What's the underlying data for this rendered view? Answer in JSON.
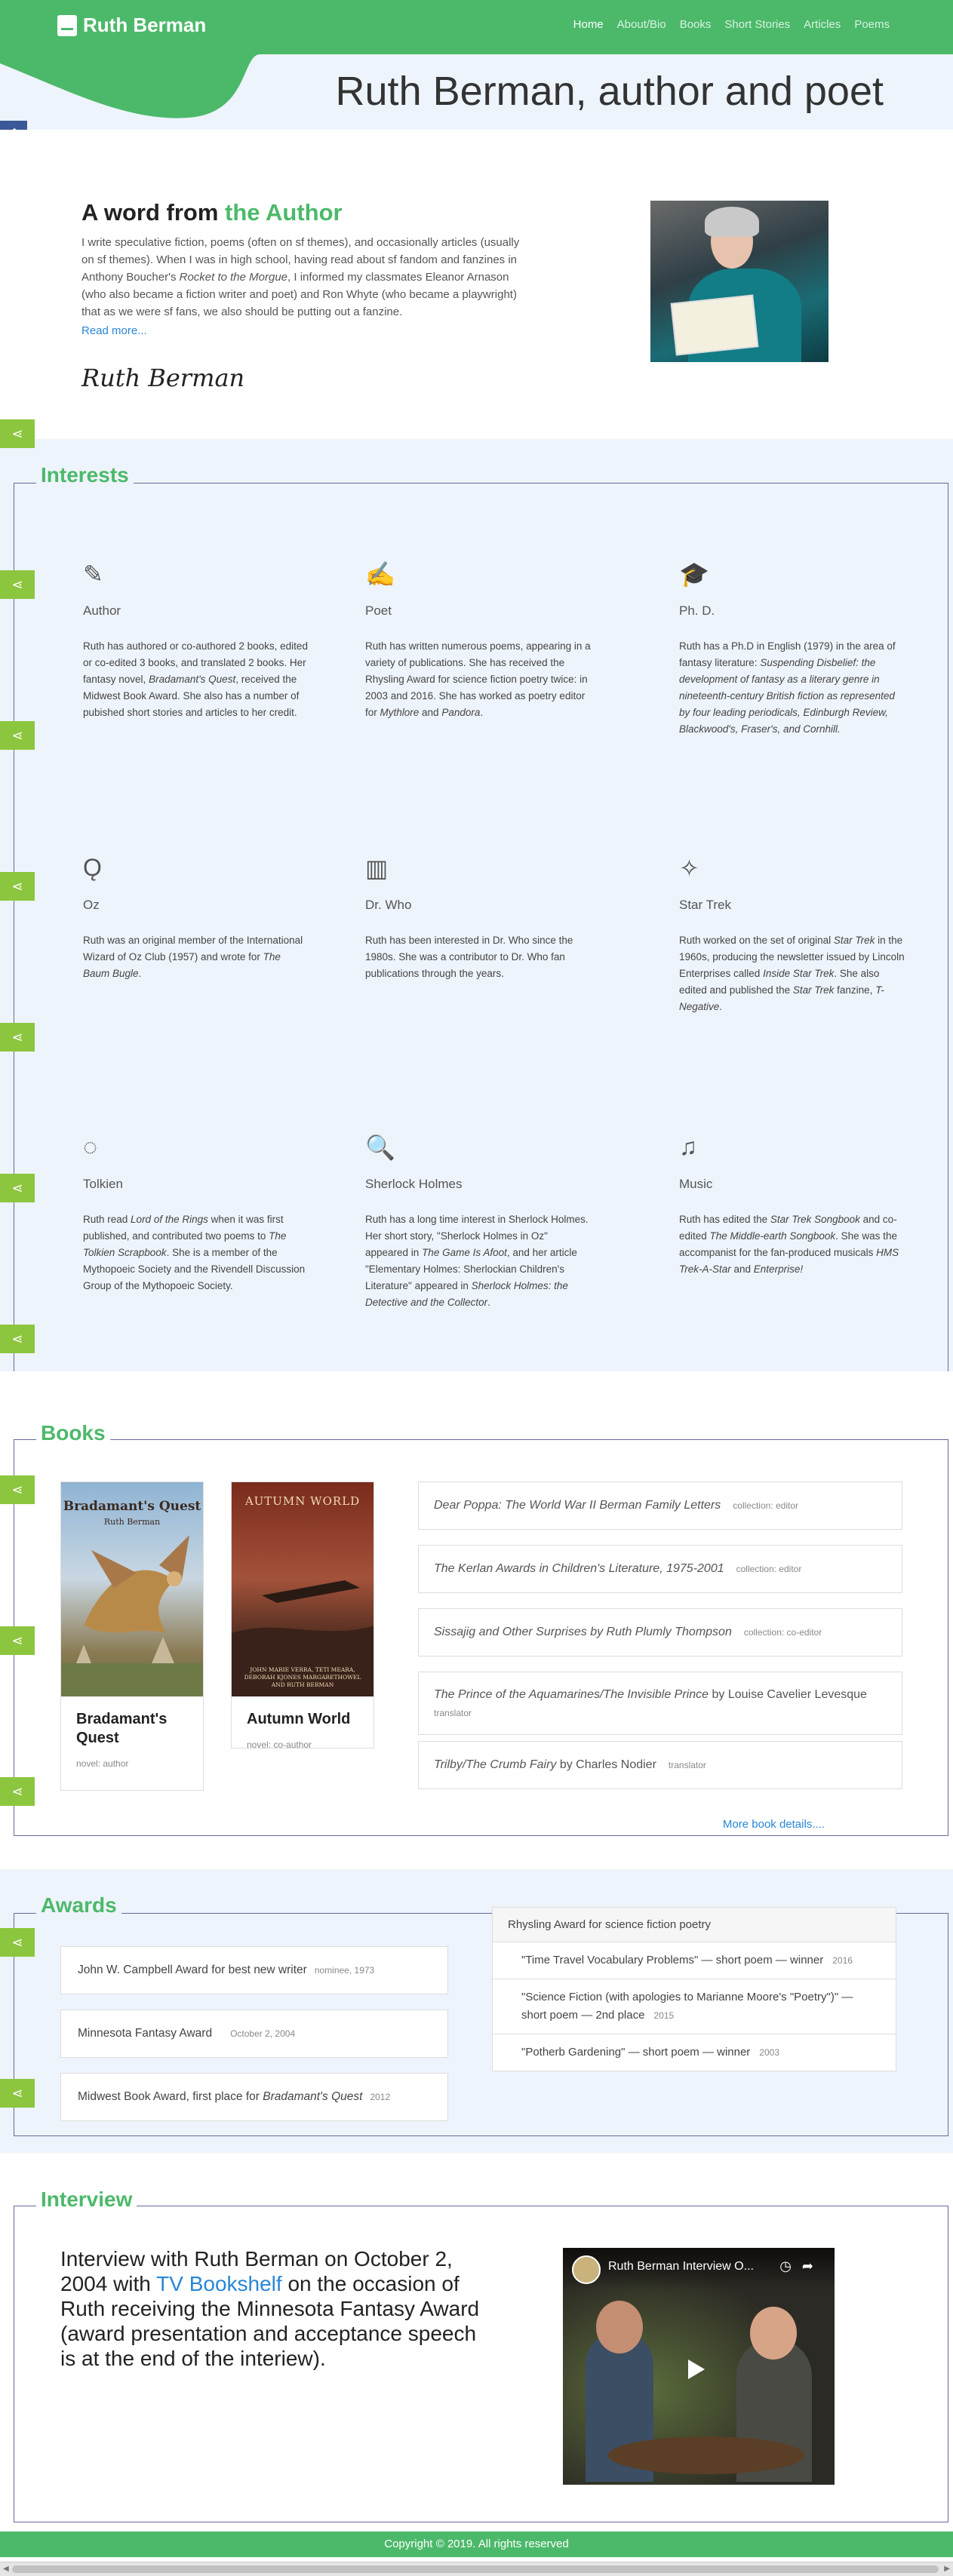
{
  "brand": "Ruth Berman",
  "nav": [
    "Home",
    "About/Bio",
    "Books",
    "Short Stories",
    "Articles",
    "Poems"
  ],
  "hero_title": "Ruth Berman, author and poet",
  "social_icons": {
    "facebook": "f",
    "twitter": "twitter-bird",
    "pinterest": "p",
    "email": "envelope",
    "share": "share"
  },
  "author": {
    "heading_prefix": "A word from",
    "heading_accent": "the Author",
    "bio_1": "I write speculative fiction, poems (often on sf themes), and occasionally articles (usually on sf themes). When I was in high school, having read about sf fandom and fanzines in Anthony Boucher's ",
    "bio_italic": "Rocket to the Morgue",
    "bio_2": ", I informed my classmates Eleanor Arnason (who also became a fiction writer and poet) and Ron Whyte (who became a playwright) that as we were sf fans, we also should be putting out a fanzine.",
    "read_more": "Read more...",
    "signature": "Ruth Berman"
  },
  "interests": {
    "title": "Interests",
    "items": [
      {
        "name": "Author",
        "icon": "✎",
        "text": "Ruth has authored or co-authored 2 books, edited or co-edited 3 books, and translated 2 books. Her fantasy novel, <i>Bradamant's Quest</i>, received the Midwest Book Award. She also has a number of pubished short stories and articles to her credit."
      },
      {
        "name": "Poet",
        "icon": "✍",
        "text": "Ruth has written numerous poems, appearing in a variety of publications. She has received the Rhysling Award for science fiction poetry twice: in 2003 and 2016. She has worked as poetry editor for <i>Mythlore</i> and <i>Pandora</i>."
      },
      {
        "name": "Ph. D.",
        "icon": "🎓",
        "text": "Ruth has a Ph.D in English (1979) in the area of fantasy literature: <i>Suspending Disbelief: the development of fantasy as a literary genre in nineteenth-century British fiction as represented by four leading periodicals, Edinburgh Review, Blackwood's, Fraser's, and Cornhill.</i>"
      },
      {
        "name": "Oz",
        "icon": "Ǫ",
        "text": "Ruth was an original member of the International Wizard of Oz Club (1957) and wrote for <i>The Baum Bugle</i>."
      },
      {
        "name": "Dr. Who",
        "icon": "▥",
        "text": "Ruth has been interested in Dr. Who since the 1980s. She was a contributor to Dr. Who fan publications through the years."
      },
      {
        "name": "Star Trek",
        "icon": "✧",
        "text": "Ruth worked on the set of original <i>Star Trek</i> in the 1960s, producing the newsletter issued by Lincoln Enterprises called <i>Inside Star Trek</i>. She also edited and published the <i>Star Trek</i> fanzine, <i>T-Negative</i>."
      },
      {
        "name": "Tolkien",
        "icon": "◌",
        "text": "Ruth read <i>Lord of the Rings</i> when it was first published, and contributed two poems to <i>The Tolkien Scrapbook</i>. She is a member of the Mythopoeic Society and the Rivendell Discussion Group of the Mythopoeic Society."
      },
      {
        "name": "Sherlock Holmes",
        "icon": "🔍",
        "text": "Ruth has a long time interest in Sherlock Holmes. Her short story, \"Sherlock Holmes in Oz\" appeared in <i>The Game Is Afoot</i>, and her article \"Elementary Holmes: Sherlockian Children's Literature\" appeared in <i>Sherlock Holmes: the Detective and the Collector</i>."
      },
      {
        "name": "Music",
        "icon": "♫",
        "text": "Ruth has edited the <i>Star Trek Songbook</i> and co-edited <i>The Middle-earth Songbook</i>. She was the accompanist for the fan-produced musicals <i>HMS Trek-A-Star</i> and <i>Enterprise!</i>"
      }
    ]
  },
  "books": {
    "title": "Books",
    "covers": [
      {
        "title": "Bradamant's Quest",
        "role": "novel: author",
        "cover_title": "Bradamant's Quest",
        "cover_author": "Ruth Berman"
      },
      {
        "title": "Autumn World",
        "role": "novel: co-author",
        "cover_title": "AUTUMN WORLD",
        "cover_authors": "JOHN MARIE VERRA, TETI MEARA, DEBORAH KJONES MARGARETHOWEL AND RUTH BERMAN"
      }
    ],
    "list": [
      {
        "title": "Dear Poppa: The World War II Berman Family Letters",
        "by": "",
        "role": "collection: editor"
      },
      {
        "title": "The Kerlan Awards in Children's Literature, 1975-2001",
        "by": "",
        "role": "collection: editor"
      },
      {
        "title": "Sissajig and Other Surprises by Ruth Plumly Thompson",
        "by": "",
        "role": "collection: co-editor"
      },
      {
        "title": "The Prince of the Aquamarines/The Invisible Prince",
        "by": " by Louise Cavelier Levesque",
        "role": "translator"
      },
      {
        "title": "Trilby/The Crumb Fairy",
        "by": " by Charles Nodier",
        "role": "translator"
      }
    ],
    "more": "More book details...."
  },
  "awards": {
    "title": "Awards",
    "left": [
      {
        "name": "John W. Campbell Award for best new writer",
        "detail": "nominee, 1973"
      },
      {
        "name": "Minnesota Fantasy Award",
        "detail": "October 2, 2004"
      },
      {
        "name_prefix": "Midwest Book Award, first place for ",
        "name_italic": "Bradamant's Quest",
        "detail": "2012"
      }
    ],
    "rhysling": {
      "heading": "Rhysling Award for science fiction poetry",
      "rows": [
        {
          "text": "\"Time Travel Vocabulary Problems\" — short poem — winner",
          "year": "2016"
        },
        {
          "text": "\"Science Fiction (with apologies to Marianne Moore's \"Poetry\")\" — short poem — 2nd place",
          "year": "2015"
        },
        {
          "text": "\"Potherb Gardening\" — short poem — winner",
          "year": "2003"
        }
      ]
    }
  },
  "interview": {
    "title": "Interview",
    "text_1": "Interview with Ruth Berman on October 2, 2004 with ",
    "link": "TV Bookshelf",
    "text_2": " on the occasion of Ruth receiving the Minnesota Fantasy Award (award presentation and acceptance speech is at the end of the interiew).",
    "video_title": "Ruth Berman Interview O..."
  },
  "footer": "Copyright © 2019. All rights reserved",
  "colors": {
    "accent": "#4cb96a",
    "share": "#8cc63f",
    "link": "#2a86d6",
    "light_bg": "#eef4fb"
  }
}
